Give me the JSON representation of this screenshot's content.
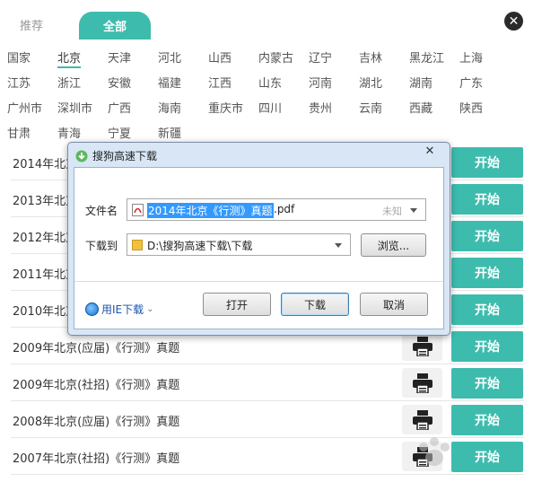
{
  "tabs": {
    "recommended": "推荐",
    "all": "全部"
  },
  "regions": [
    "国家",
    "北京",
    "天津",
    "河北",
    "山西",
    "内蒙古",
    "辽宁",
    "吉林",
    "黑龙江",
    "上海",
    "江苏",
    "浙江",
    "安徽",
    "福建",
    "江西",
    "山东",
    "河南",
    "湖北",
    "湖南",
    "广东",
    "广州市",
    "深圳市",
    "广西",
    "海南",
    "重庆市",
    "四川",
    "贵州",
    "云南",
    "西藏",
    "陕西",
    "甘肃",
    "青海",
    "宁夏",
    "新疆"
  ],
  "active_region": "北京",
  "list": {
    "start_label": "开始",
    "rows": [
      "2014年北京",
      "2013年北京",
      "2012年北京",
      "2011年北京",
      "2010年北京",
      "2009年北京(应届)《行测》真题",
      "2009年北京(社招)《行测》真题",
      "2008年北京(应届)《行测》真题",
      "2007年北京(社招)《行测》真题"
    ]
  },
  "dialog": {
    "title": "搜狗高速下载",
    "filename_label": "文件名",
    "filename_selected": "2014年北京《行测》真题",
    "filename_ext": ".pdf",
    "size_unknown": "未知",
    "saveto_label": "下载到",
    "save_path": "D:\\搜狗高速下载\\下载",
    "browse_label": "浏览...",
    "ie_link": "用IE下载",
    "open_label": "打开",
    "download_label": "下载",
    "cancel_label": "取消"
  },
  "colors": {
    "accent": "#3dbcae",
    "dialog_frame": "#d8e6f5",
    "selection": "#3399ff"
  }
}
